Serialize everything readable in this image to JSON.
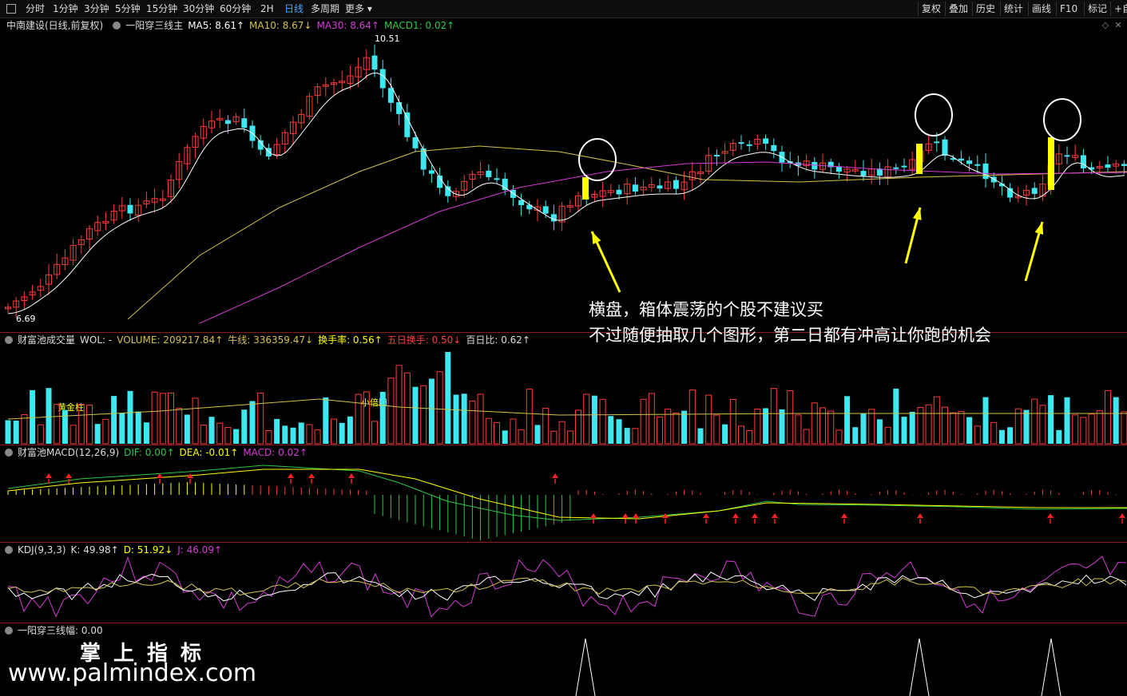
{
  "toolbar": {
    "periods": [
      "分时",
      "1分钟",
      "3分钟",
      "5分钟",
      "15分钟",
      "30分钟",
      "60分钟",
      "2H",
      "日线",
      "多周期",
      "更多"
    ],
    "active_period": "日线",
    "right_buttons": [
      "复权",
      "叠加",
      "历史",
      "统计",
      "画线",
      "F10",
      "标记",
      "+自"
    ]
  },
  "main": {
    "stock": "中南建设(日线,前复权)",
    "indicator": "一阳穿三线主",
    "ma5": "MA5: 8.61↑",
    "ma10": "MA10: 8.67↓",
    "ma30": "MA30: 8.64↑",
    "macd1": "MACD1: 0.02↑",
    "high_label": "10.51",
    "low_label": "6.69"
  },
  "volume": {
    "name": "财富池成交量",
    "wol": "WOL: -",
    "volume": "VOLUME: 209217.84↑",
    "niu": "牛线: 336359.47↓",
    "hsl": "换手率: 0.56↑",
    "wrhs": "五日换手: 0.50↓",
    "brb": "百日比: 0.62↑",
    "tag1": "黄金柱",
    "tag2": "小倍阳"
  },
  "macd": {
    "name": "财富池MACD(12,26,9)",
    "dif": "DIF: 0.00↑",
    "dea": "DEA: -0.01↑",
    "macd": "MACD: 0.02↑"
  },
  "kdj": {
    "name": "KDJ(9,3,3)",
    "k": "K: 49.98↑",
    "d": "D: 51.92↓",
    "j": "J: 46.09↑"
  },
  "signal": {
    "name": "一阳穿三线幅",
    "value": ": 0.00"
  },
  "annotation": {
    "line1": "横盘，箱体震荡的个股不建议买",
    "line2": "不过随便抽取几个图形，第二日都有冲高让你跑的机会"
  },
  "watermark": {
    "cn": "掌上指标",
    "url": "www.palmindex.com"
  },
  "colors": {
    "up": "#ff3b3b",
    "down": "#3ee8f0",
    "ma5": "#ffffff",
    "ma10": "#d4c24a",
    "ma30": "#d63ad6",
    "signal_bar": "#ffff00"
  }
}
